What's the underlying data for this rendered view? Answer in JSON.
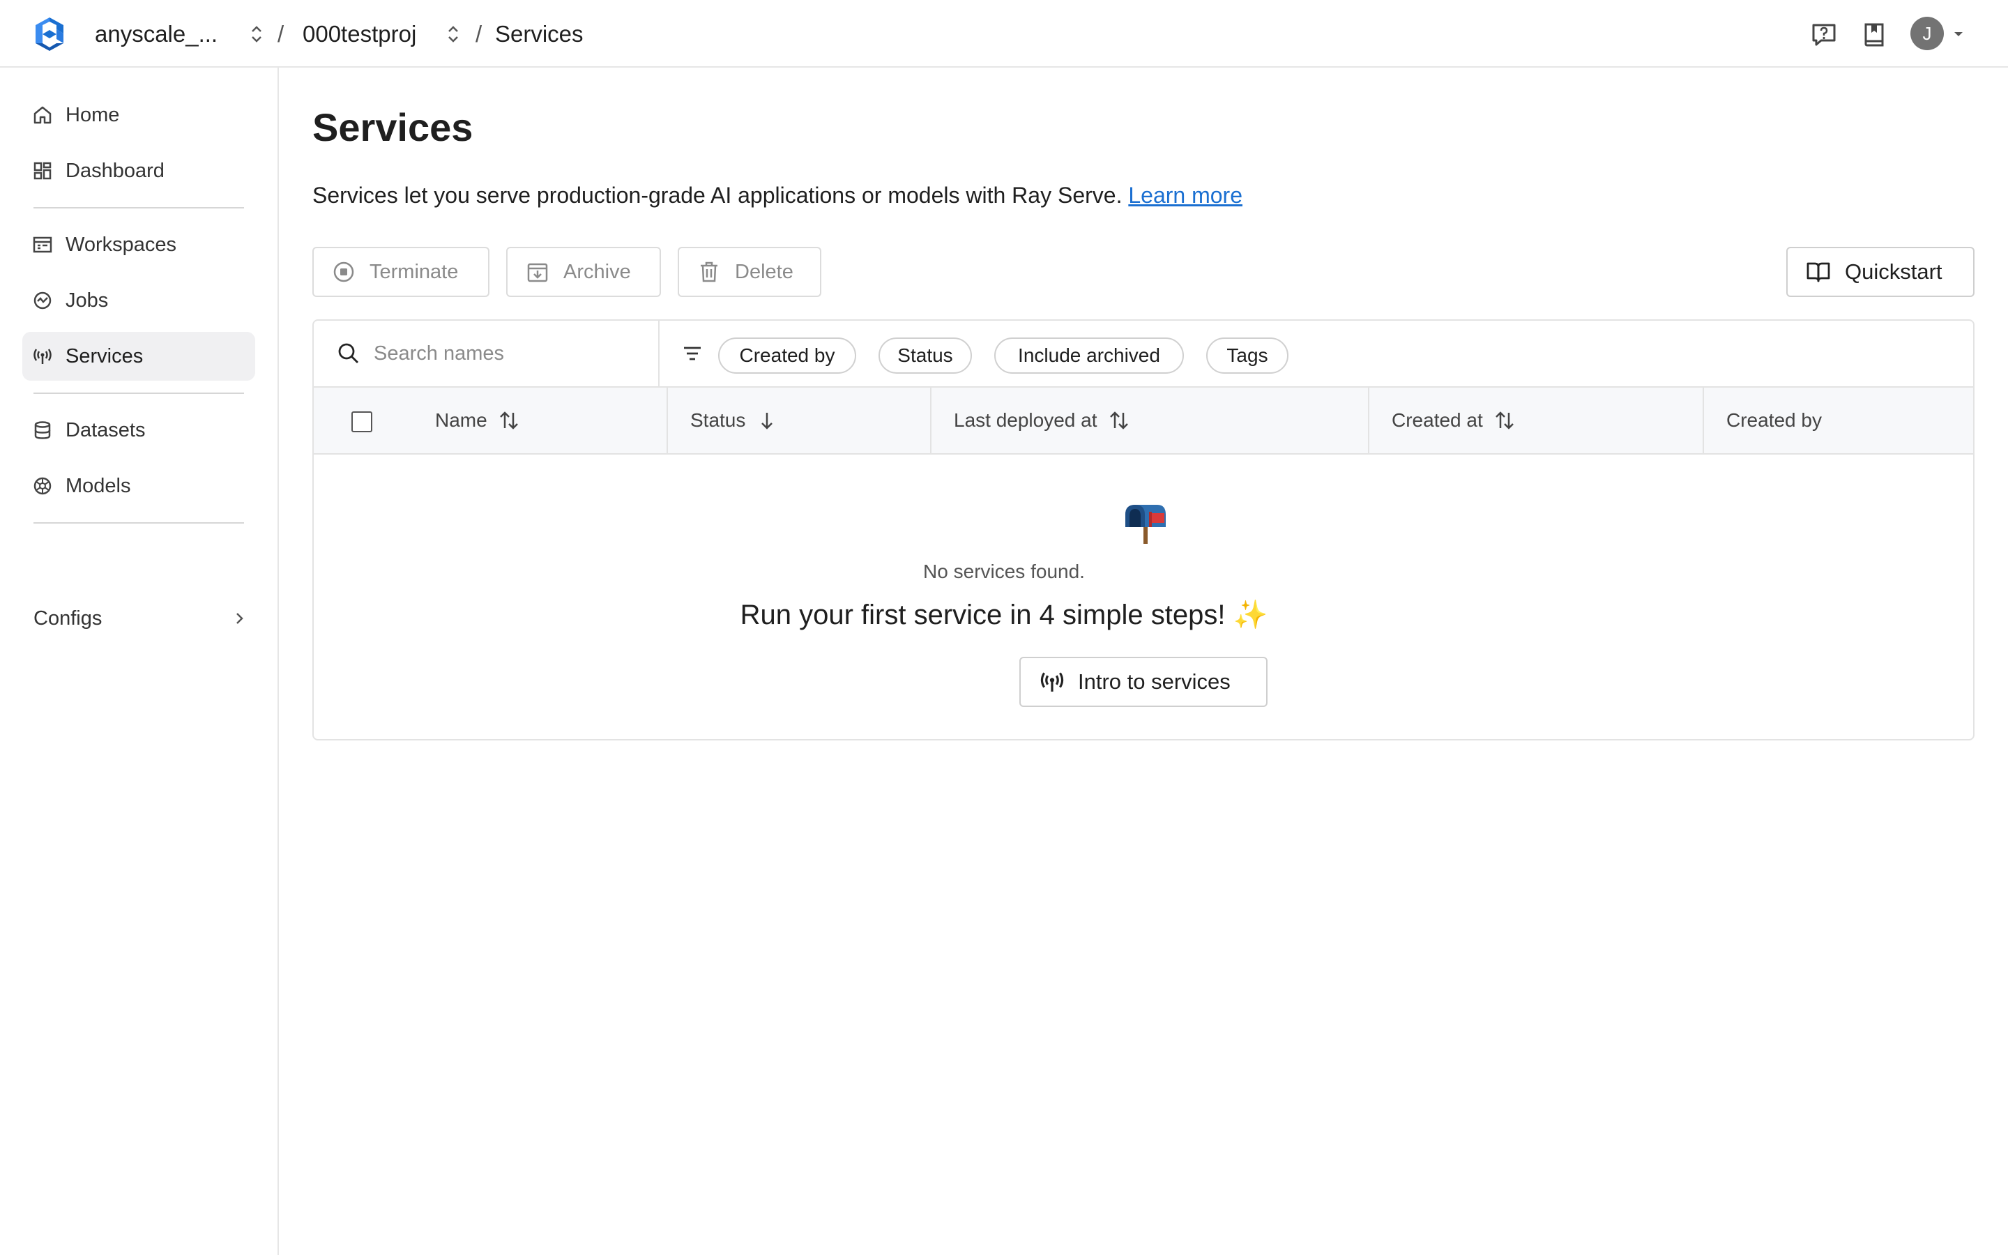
{
  "topbar": {
    "org": "anyscale_...",
    "project": "000testproj",
    "page": "Services",
    "separator": "/",
    "avatar_initial": "J"
  },
  "sidebar": {
    "items": [
      {
        "label": "Home",
        "icon": "home-icon"
      },
      {
        "label": "Dashboard",
        "icon": "dashboard-icon"
      },
      {
        "label": "Workspaces",
        "icon": "workspaces-icon"
      },
      {
        "label": "Jobs",
        "icon": "jobs-icon"
      },
      {
        "label": "Services",
        "icon": "services-icon",
        "active": true
      },
      {
        "label": "Datasets",
        "icon": "datasets-icon"
      },
      {
        "label": "Models",
        "icon": "models-icon"
      }
    ],
    "configs_label": "Configs"
  },
  "main": {
    "title": "Services",
    "description": "Services let you serve production-grade AI applications or models with Ray Serve.",
    "learn_more": "Learn more",
    "actions": {
      "terminate": "Terminate",
      "archive": "Archive",
      "delete": "Delete",
      "quickstart": "Quickstart"
    },
    "search": {
      "placeholder": "Search names"
    },
    "filters": [
      "Created by",
      "Status",
      "Include archived",
      "Tags"
    ],
    "columns": [
      "Name",
      "Status",
      "Last deployed at",
      "Created at",
      "Created by"
    ],
    "empty": {
      "icon": "mailbox-icon",
      "message": "No services found.",
      "headline": "Run your first service in 4 simple steps! ✨",
      "cta": "Intro to services"
    }
  },
  "colors": {
    "brand": "#1a6fd1",
    "active_bg": "#f0f0f2",
    "border": "#e3e3e3"
  }
}
